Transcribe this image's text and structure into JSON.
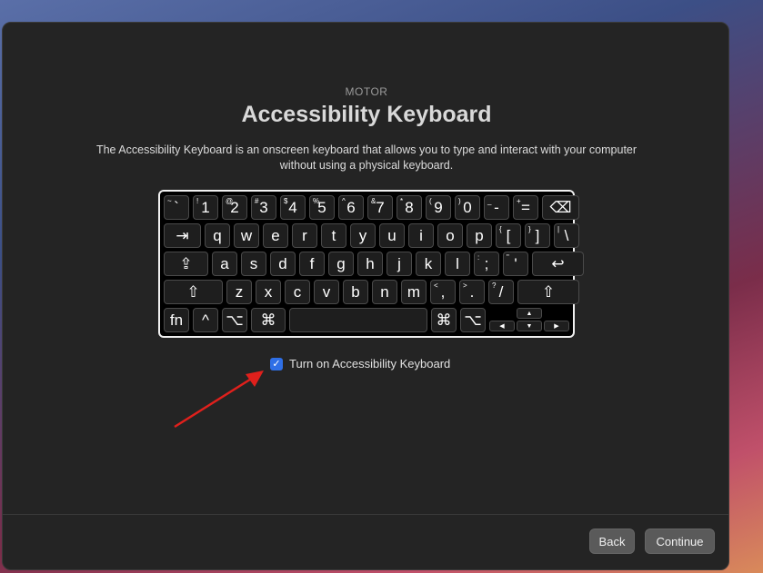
{
  "header": {
    "eyebrow": "MOTOR",
    "title": "Accessibility Keyboard"
  },
  "description": "The Accessibility Keyboard is an onscreen keyboard that allows you to type and interact with your computer without using a physical keyboard.",
  "keyboard": {
    "row1": [
      {
        "sec": "~",
        "pri": "`"
      },
      {
        "sec": "!",
        "pri": "1"
      },
      {
        "sec": "@",
        "pri": "2"
      },
      {
        "sec": "#",
        "pri": "3"
      },
      {
        "sec": "$",
        "pri": "4"
      },
      {
        "sec": "%",
        "pri": "5"
      },
      {
        "sec": "^",
        "pri": "6"
      },
      {
        "sec": "&",
        "pri": "7"
      },
      {
        "sec": "*",
        "pri": "8"
      },
      {
        "sec": "(",
        "pri": "9"
      },
      {
        "sec": ")",
        "pri": "0"
      },
      {
        "sec": "_",
        "pri": "-"
      },
      {
        "sec": "+",
        "pri": "="
      },
      {
        "sec": "",
        "pri": "⌫"
      }
    ],
    "row2": [
      {
        "sec": "",
        "pri": "⇥"
      },
      {
        "sec": "",
        "pri": "q"
      },
      {
        "sec": "",
        "pri": "w"
      },
      {
        "sec": "",
        "pri": "e"
      },
      {
        "sec": "",
        "pri": "r"
      },
      {
        "sec": "",
        "pri": "t"
      },
      {
        "sec": "",
        "pri": "y"
      },
      {
        "sec": "",
        "pri": "u"
      },
      {
        "sec": "",
        "pri": "i"
      },
      {
        "sec": "",
        "pri": "o"
      },
      {
        "sec": "",
        "pri": "p"
      },
      {
        "sec": "{",
        "pri": "["
      },
      {
        "sec": "}",
        "pri": "]"
      },
      {
        "sec": "|",
        "pri": "\\"
      }
    ],
    "row3": [
      {
        "sec": "",
        "pri": "⇪"
      },
      {
        "sec": "",
        "pri": "a"
      },
      {
        "sec": "",
        "pri": "s"
      },
      {
        "sec": "",
        "pri": "d"
      },
      {
        "sec": "",
        "pri": "f"
      },
      {
        "sec": "",
        "pri": "g"
      },
      {
        "sec": "",
        "pri": "h"
      },
      {
        "sec": "",
        "pri": "j"
      },
      {
        "sec": "",
        "pri": "k"
      },
      {
        "sec": "",
        "pri": "l"
      },
      {
        "sec": ":",
        "pri": ";"
      },
      {
        "sec": "\"",
        "pri": "'"
      },
      {
        "sec": "",
        "pri": "↩"
      }
    ],
    "row4": [
      {
        "sec": "",
        "pri": "⇧"
      },
      {
        "sec": "",
        "pri": "z"
      },
      {
        "sec": "",
        "pri": "x"
      },
      {
        "sec": "",
        "pri": "c"
      },
      {
        "sec": "",
        "pri": "v"
      },
      {
        "sec": "",
        "pri": "b"
      },
      {
        "sec": "",
        "pri": "n"
      },
      {
        "sec": "",
        "pri": "m"
      },
      {
        "sec": "<",
        "pri": ","
      },
      {
        "sec": ">",
        "pri": "."
      },
      {
        "sec": "?",
        "pri": "/"
      },
      {
        "sec": "",
        "pri": "⇧"
      }
    ],
    "row5": [
      {
        "sec": "",
        "pri": "fn"
      },
      {
        "sec": "",
        "pri": "^"
      },
      {
        "sec": "",
        "pri": "⌥"
      },
      {
        "sec": "",
        "pri": "⌘"
      },
      {
        "sec": "",
        "pri": ""
      },
      {
        "sec": "",
        "pri": "⌘"
      },
      {
        "sec": "",
        "pri": "⌥"
      }
    ],
    "arrows": {
      "up": "▲",
      "left": "◀",
      "down": "▼",
      "right": "▶"
    }
  },
  "checkbox": {
    "label": "Turn on Accessibility Keyboard",
    "checked": true,
    "mark": "✓"
  },
  "footer": {
    "back_label": "Back",
    "continue_label": "Continue"
  },
  "colors": {
    "accent": "#2f6fe6",
    "annotation_arrow": "#e0201c"
  }
}
